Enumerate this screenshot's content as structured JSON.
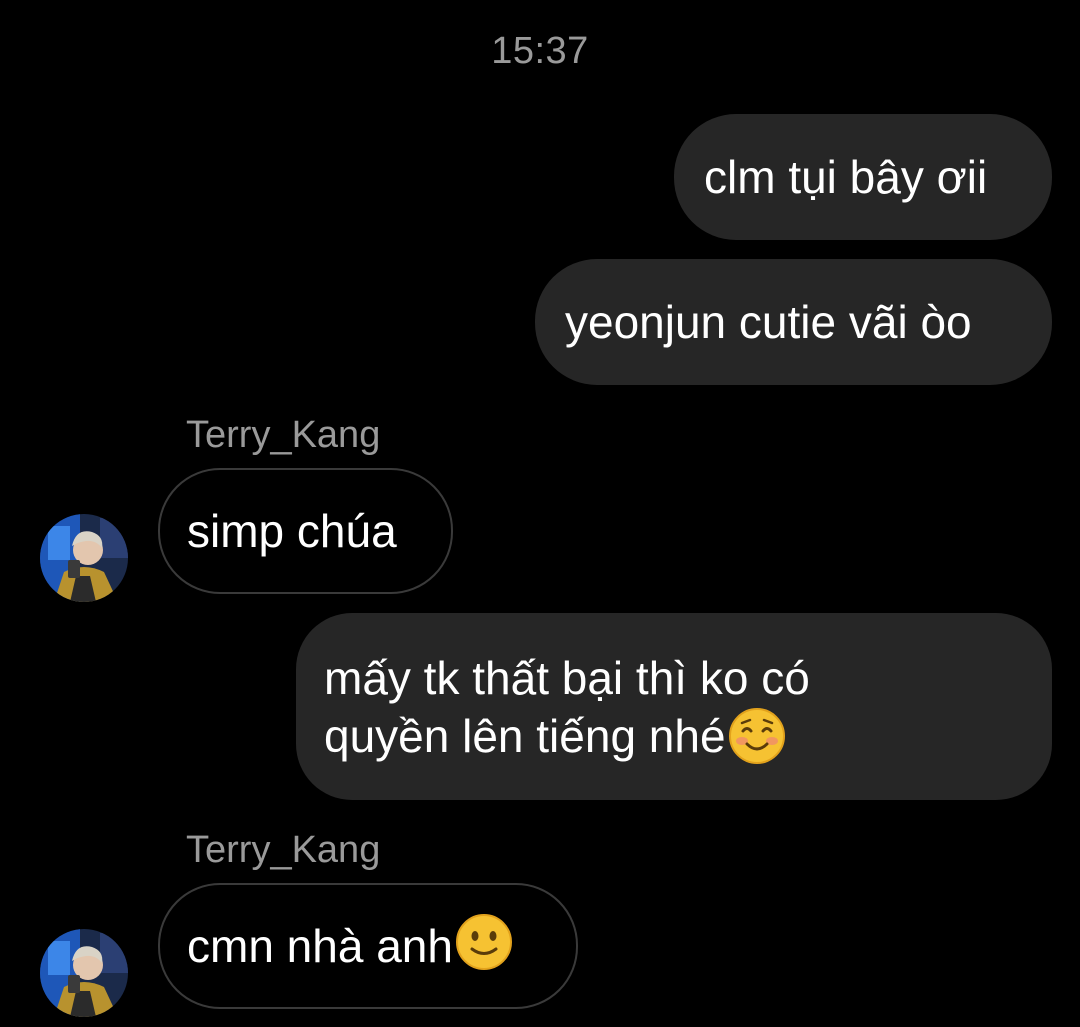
{
  "chat": {
    "timestamp": "15:37",
    "messages": [
      {
        "direction": "outgoing",
        "text": "clm tụi bây ơii"
      },
      {
        "direction": "outgoing",
        "text": "yeonjun cutie vãi òo"
      },
      {
        "direction": "incoming",
        "sender": "Terry_Kang",
        "text": "simp chúa"
      },
      {
        "direction": "outgoing",
        "lines": [
          "mấy tk thất bại thì ko có",
          "quyền lên tiếng nhé"
        ],
        "emoji": "smiling-face-icon"
      },
      {
        "direction": "incoming",
        "sender": "Terry_Kang",
        "text": "cmn nhà anh",
        "emoji": "slightly-smiling-face-icon"
      }
    ]
  },
  "colors": {
    "background": "#000000",
    "outgoing_bubble": "#262626",
    "incoming_bubble_border": "#3a3a3a",
    "secondary_text": "#9a9a9a",
    "message_text": "#ffffff"
  }
}
